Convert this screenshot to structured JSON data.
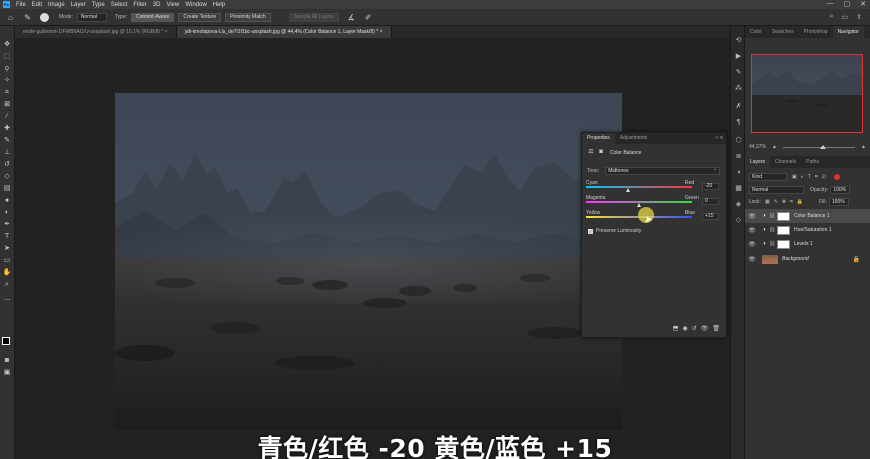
{
  "app": {
    "logo": "Ps"
  },
  "menu": [
    "File",
    "Edit",
    "Image",
    "Layer",
    "Type",
    "Select",
    "Filter",
    "3D",
    "View",
    "Window",
    "Help"
  ],
  "window_controls": [
    "—",
    "▢",
    "✕"
  ],
  "options": {
    "mode_label": "Mode:",
    "mode_value": "Normal",
    "type_label": "Type:",
    "buttons": [
      "Content-Aware",
      "Create Texture",
      "Proximity Match"
    ],
    "sample_all": "Sample All Layers"
  },
  "tabs": [
    {
      "label": "emile-guillemot-1IFWB6ACrU-unsplash.jpg @ 15,1% (RGB/8) *  ×"
    },
    {
      "label": "jafi-kmotapova-Lls_de7I1f1bc-unsplash.jpg @ 44,4% (Color Balance 1, Layer Mask/8) *  ×"
    }
  ],
  "navigator": {
    "tabs": [
      "Color",
      "Swatches",
      "Photoshop",
      "Navigator"
    ],
    "zoom": "44,37%",
    "zoom_fraction": 0.55
  },
  "layers": {
    "tabs": [
      "Layers",
      "Channels",
      "Paths"
    ],
    "filter_label": "Kind",
    "blend": "Normal",
    "opacity_label": "Opacity:",
    "opacity": "100%",
    "lock_label": "Lock:",
    "fill_label": "Fill:",
    "fill": "100%",
    "items": [
      {
        "name": "Color Balance 1",
        "selected": true,
        "type": "adj"
      },
      {
        "name": "Hue/Saturation 1",
        "selected": false,
        "type": "adj"
      },
      {
        "name": "Levels 1",
        "selected": false,
        "type": "adj"
      },
      {
        "name": "Background",
        "selected": false,
        "type": "bg"
      }
    ]
  },
  "properties": {
    "tabs": [
      "Properties",
      "Adjustments"
    ],
    "title": "Color Balance",
    "tone_label": "Tone:",
    "tone_value": "Midtones",
    "sliders": [
      {
        "left": "Cyan",
        "right": "Red",
        "value": "-20",
        "pos": 0.4,
        "gradient": "linear-gradient(90deg,#00c8ff,#ff3030)"
      },
      {
        "left": "Magenta",
        "right": "Green",
        "value": "0",
        "pos": 0.5,
        "gradient": "linear-gradient(90deg,#ff30ff,#30e040)"
      },
      {
        "left": "Yellow",
        "right": "Blue",
        "value": "+15",
        "pos": 0.575,
        "gradient": "linear-gradient(90deg,#ffe030,#3050ff)"
      }
    ],
    "preserve": "Preserve Luminosity"
  },
  "caption": "青色/红色 -20 黄色/蓝色 +15"
}
